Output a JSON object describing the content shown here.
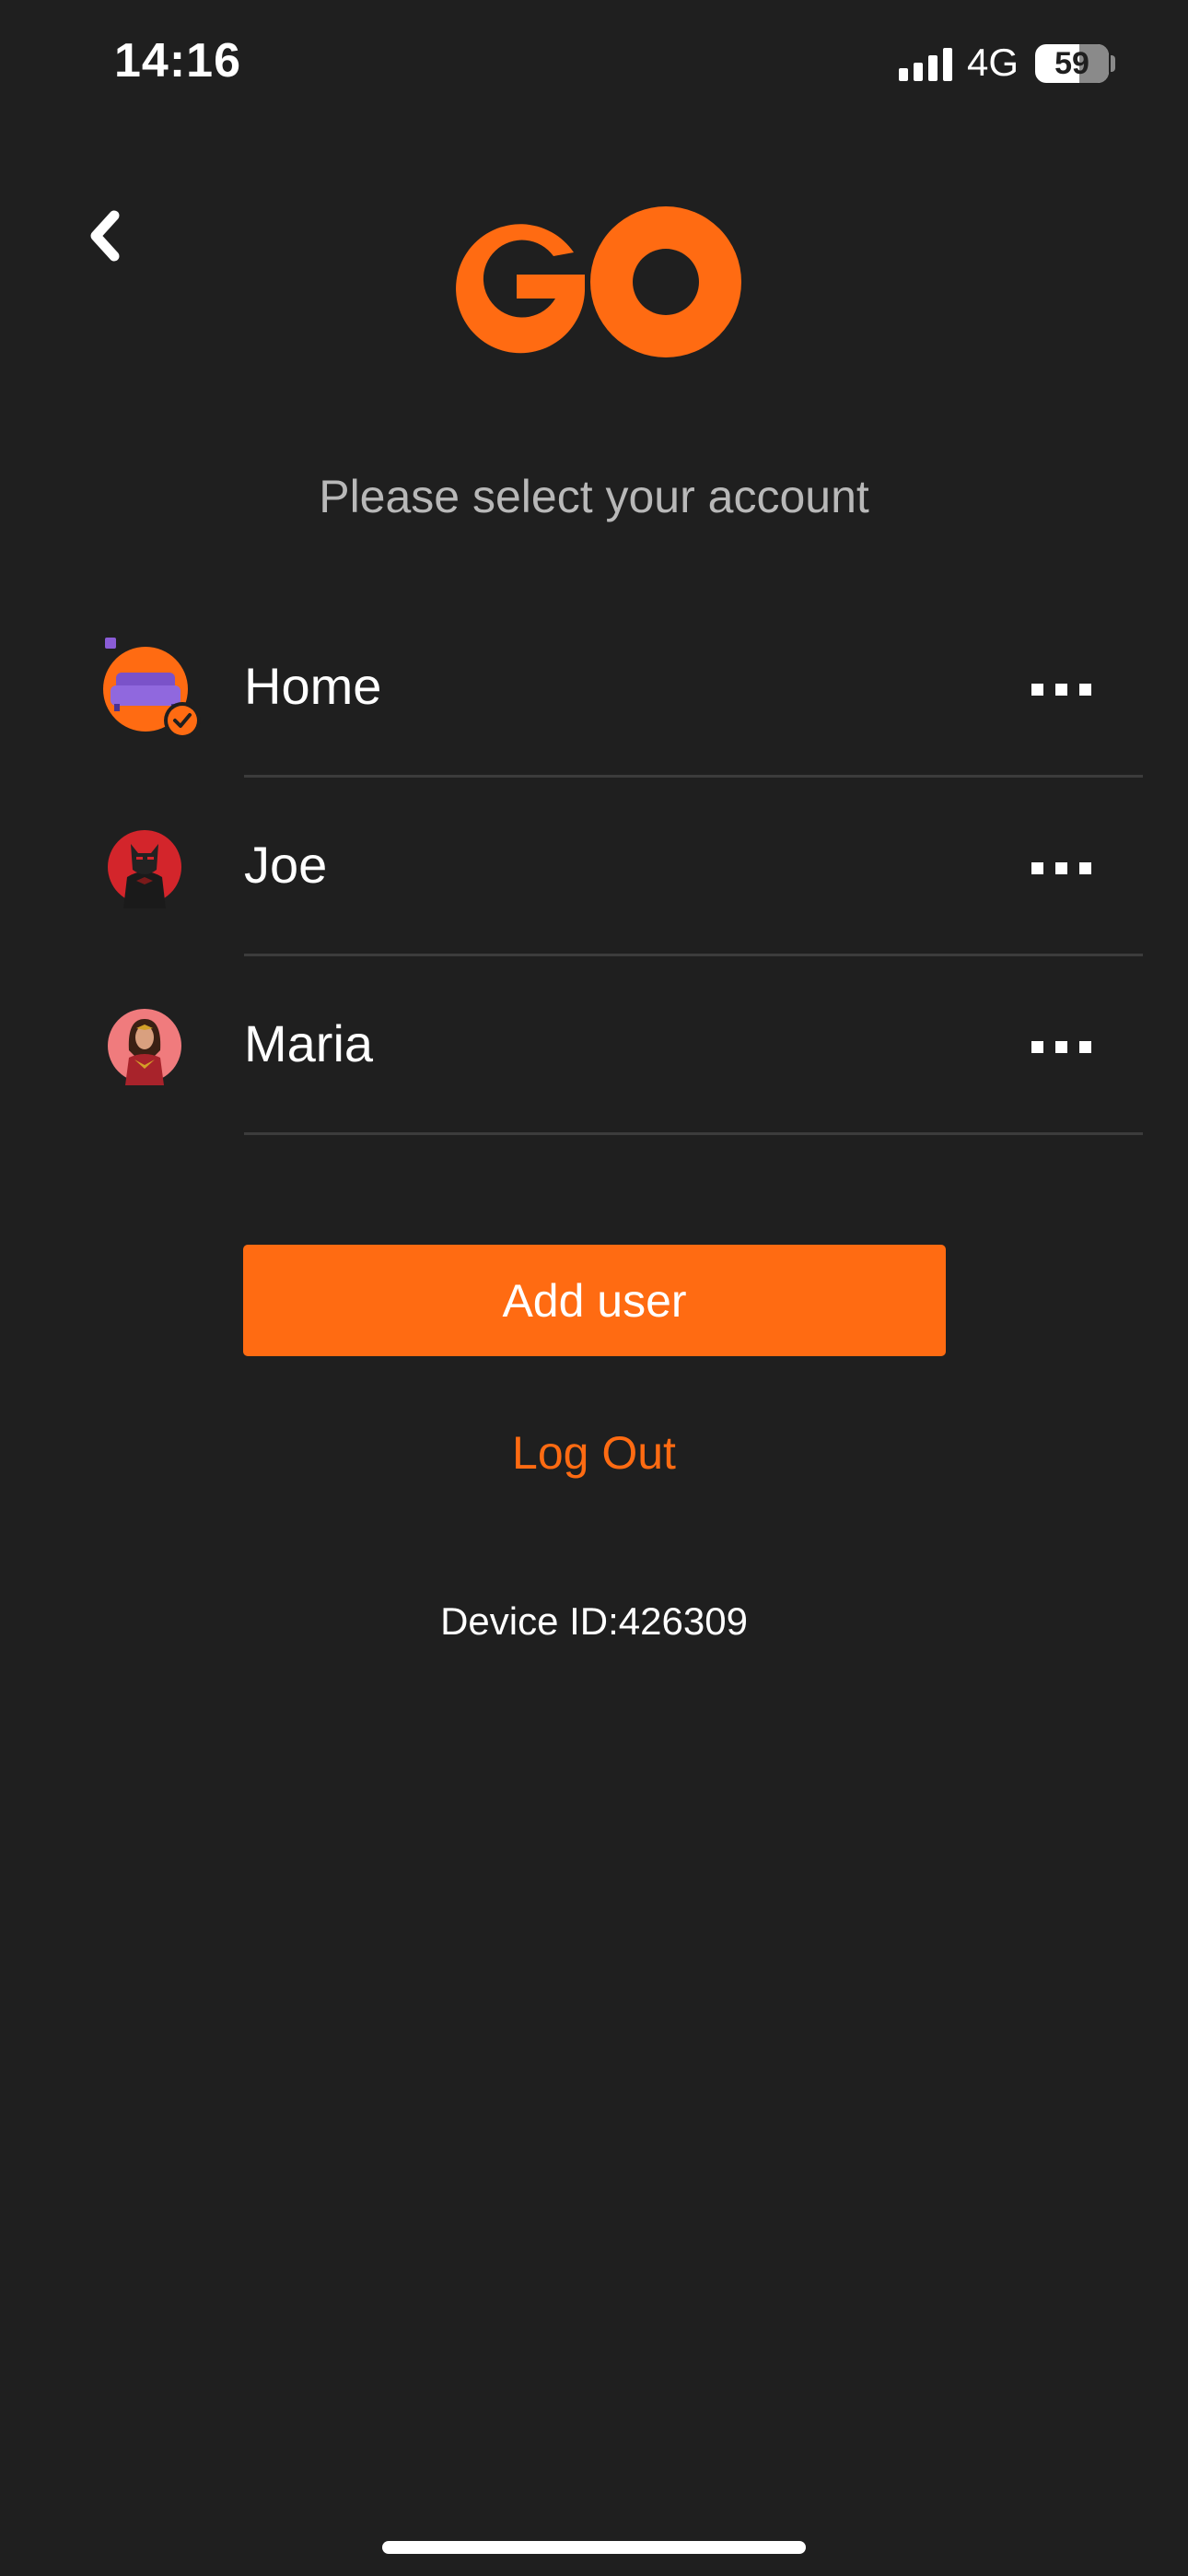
{
  "status_bar": {
    "time": "14:16",
    "network": "4G",
    "battery": "59"
  },
  "header": {
    "back_icon": "chevron-left-icon",
    "logo_text": "GO"
  },
  "title": "Please select your account",
  "accounts": [
    {
      "name": "Home",
      "avatar": "sofa-avatar",
      "selected": true,
      "more_icon": "more-icon"
    },
    {
      "name": "Joe",
      "avatar": "batman-avatar",
      "selected": false,
      "more_icon": "more-icon"
    },
    {
      "name": "Maria",
      "avatar": "wonder-woman-avatar",
      "selected": false,
      "more_icon": "more-icon"
    }
  ],
  "actions": {
    "add_user_label": "Add user",
    "logout_label": "Log Out"
  },
  "device_id": "Device ID:426309",
  "colors": {
    "background": "#1f1f1f",
    "accent": "#ff6b12",
    "divider": "#3c3c3c",
    "subtitle": "#b8b8b8"
  }
}
